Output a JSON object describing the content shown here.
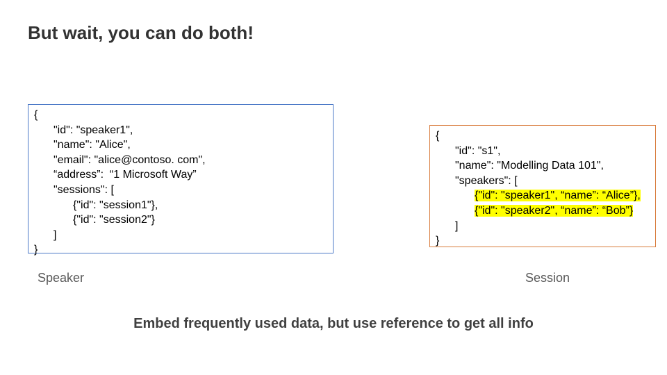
{
  "title": "But wait, you can do both!",
  "left": {
    "l0": "{",
    "l1": "\"id\": \"speaker1\",",
    "l2": "\"name\": \"Alice\",",
    "l3": "\"email\": \"alice@contoso. com\",",
    "l4": "“address”:  “1 Microsoft Way”",
    "l5": "\"sessions\": [",
    "l6": "{\"id\": \"session1\"},",
    "l7": "{\"id\": \"session2\"}",
    "l8": "]",
    "l9": "}",
    "caption": "Speaker"
  },
  "right": {
    "l0": "{",
    "l1": "\"id\": \"s1\",",
    "l2": "\"name\": \"Modelling Data 101\",",
    "l3": "\"speakers\": [",
    "l4": "{\"id\": \"speaker1\", “name”: “Alice”},",
    "l5": "{\"id\": \"speaker2\", “name”: “Bob”}",
    "l6": "]",
    "l7": "}",
    "caption": "Session"
  },
  "footer": "Embed frequently used data, but use reference to get all info"
}
